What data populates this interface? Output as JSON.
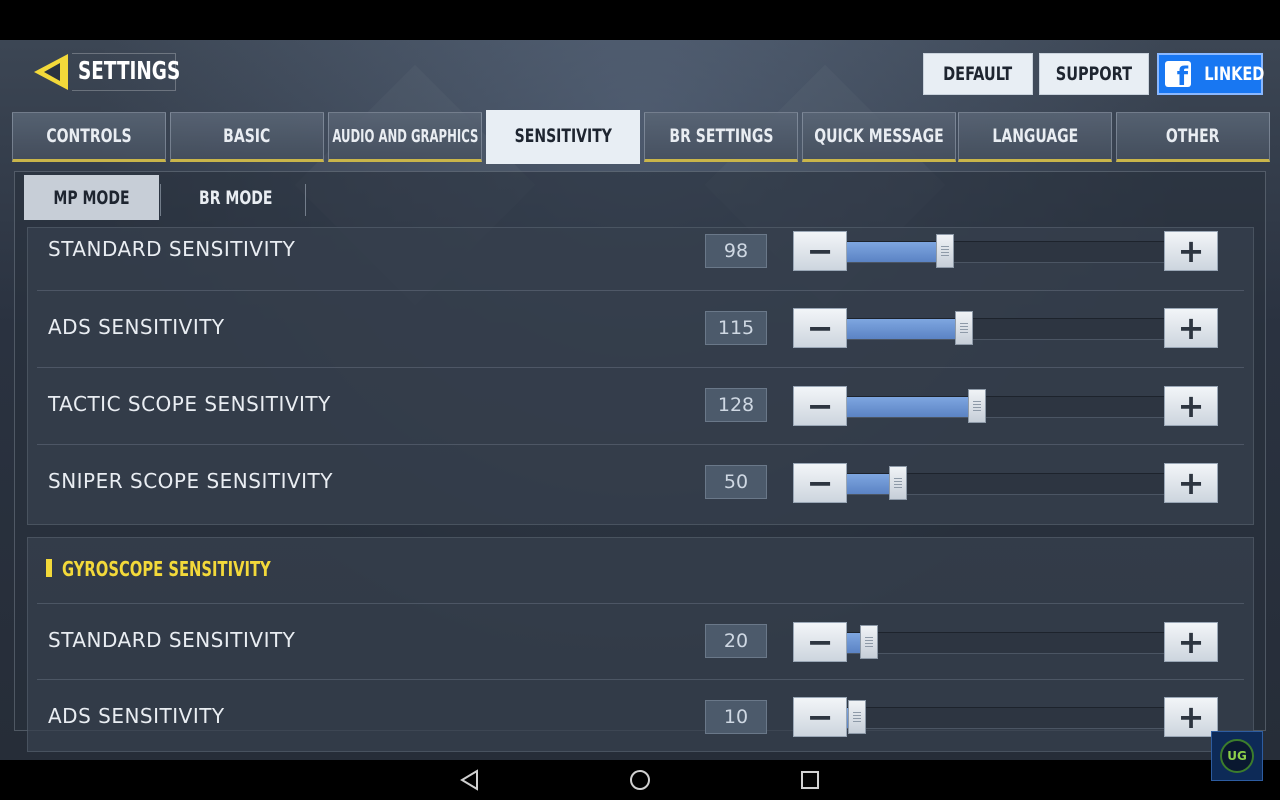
{
  "header": {
    "title": "SETTINGS",
    "buttons": {
      "default": "DEFAULT",
      "support": "SUPPORT",
      "linked": "LINKED"
    }
  },
  "tabs": [
    {
      "label": "CONTROLS",
      "active": false
    },
    {
      "label": "BASIC",
      "active": false
    },
    {
      "label": "AUDIO AND GRAPHICS",
      "active": false
    },
    {
      "label": "SENSITIVITY",
      "active": true
    },
    {
      "label": "BR SETTINGS",
      "active": false
    },
    {
      "label": "QUICK MESSAGE",
      "active": false
    },
    {
      "label": "LANGUAGE",
      "active": false
    },
    {
      "label": "OTHER",
      "active": false
    }
  ],
  "modes": {
    "mp": "MP MODE",
    "br": "BR MODE",
    "selected": "MP MODE"
  },
  "sensitivity": [
    {
      "label": "STANDARD SENSITIVITY",
      "value": "98",
      "level": 0.31
    },
    {
      "label": "ADS SENSITIVITY",
      "value": "115",
      "level": 0.37
    },
    {
      "label": "TACTIC SCOPE SENSITIVITY",
      "value": "128",
      "level": 0.41
    },
    {
      "label": "SNIPER SCOPE SENSITIVITY",
      "value": "50",
      "level": 0.16
    }
  ],
  "gyroscope": {
    "title": "GYROSCOPE SENSITIVITY",
    "rows": [
      {
        "label": "STANDARD SENSITIVITY",
        "value": "20",
        "level": 0.07
      },
      {
        "label": "ADS SENSITIVITY",
        "value": "10",
        "level": 0.03
      }
    ]
  },
  "colors": {
    "accent_yellow": "#f3d93a",
    "slider_fill": "#6b93d3",
    "facebook_blue": "#1877f2"
  },
  "icons": {
    "back": "back-arrow-icon",
    "facebook": "facebook-icon",
    "minus": "minus-icon",
    "plus": "plus-icon",
    "nav_back": "nav-back-icon",
    "nav_home": "nav-home-icon",
    "nav_recent": "nav-recent-apps-icon"
  },
  "watermark": "UG"
}
